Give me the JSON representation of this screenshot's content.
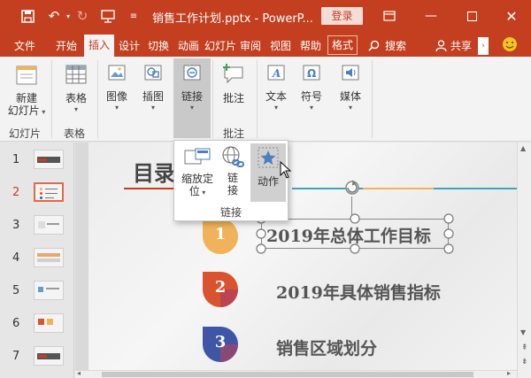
{
  "titlebar": {
    "save_icon": "save-icon",
    "undo_icon": "undo-icon",
    "redo_icon": "redo-icon",
    "present_icon": "present-from-start-icon",
    "qat_more_icon": "customize-qat-icon",
    "title": "销售工作计划.pptx - PowerP...",
    "login_label": "登录",
    "ribbon_display_icon": "ribbon-display-options-icon",
    "minimize_icon": "minimize-icon",
    "maximize_icon": "maximize-icon",
    "close_icon": "close-icon",
    "accent_color": "#c33f20"
  },
  "tabs": {
    "file": "文件",
    "home": "开始",
    "insert": "插入",
    "design": "设计",
    "transitions": "切换",
    "animations": "动画",
    "slideshow": "幻灯片",
    "review": "审阅",
    "view": "视图",
    "help": "帮助",
    "format": "格式",
    "search": "搜索",
    "share": "共享"
  },
  "ribbon": {
    "new_slide_line1": "新建",
    "new_slide_line2": "幻灯片",
    "group_slides": "幻灯片",
    "table": "表格",
    "group_tables": "表格",
    "images": "图像",
    "illustrations": "插图",
    "links": "链接",
    "comment": "批注",
    "group_comments": "批注",
    "text": "文本",
    "symbols": "符号",
    "media": "媒体"
  },
  "dropdown": {
    "zoom_line1": "缩放定",
    "zoom_line2": "位",
    "link_line1": "链",
    "link_line2": "接",
    "action": "动作",
    "group_label": "链接"
  },
  "thumbnails": [
    "1",
    "2",
    "3",
    "4",
    "5",
    "6",
    "7"
  ],
  "selected_slide": "2",
  "slide": {
    "title": "目录",
    "items": [
      {
        "num": "1",
        "text": "2019年总体工作目标",
        "color": "#f0b25a"
      },
      {
        "num": "2",
        "text": "2019年具体销售指标",
        "color": "#d9532f"
      },
      {
        "num": "3",
        "text": "销售区域划分",
        "color": "#3f56a6"
      }
    ]
  }
}
